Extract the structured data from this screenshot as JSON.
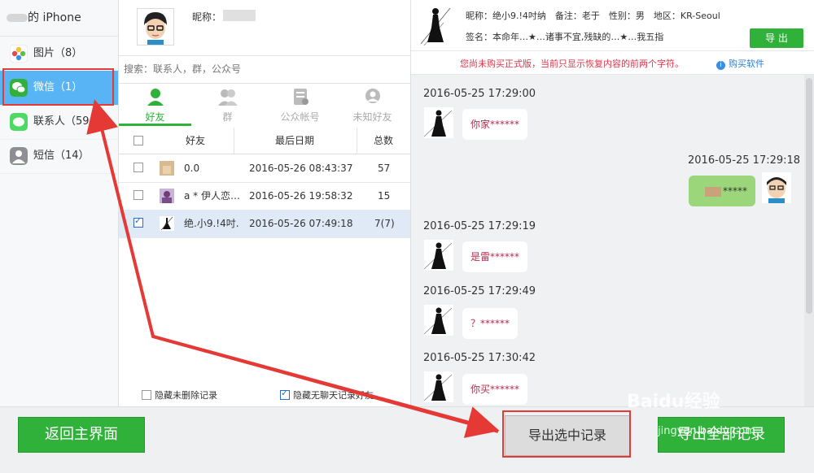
{
  "sidebar": {
    "device_label": "的 iPhone",
    "items": [
      {
        "label": "图片（8）",
        "icon": "photos-icon",
        "active": false
      },
      {
        "label": "微信（1）",
        "icon": "wechat-icon",
        "active": true
      },
      {
        "label": "联系人（59",
        "icon": "contacts-icon",
        "active": false
      },
      {
        "label": "短信（14）",
        "icon": "sms-icon",
        "active": false
      }
    ]
  },
  "account": {
    "nickname_label": "昵称："
  },
  "search": {
    "placeholder": "搜索：联系人，群，公众号"
  },
  "tabs": [
    {
      "label": "好友",
      "icon": "friend-icon",
      "active": true
    },
    {
      "label": "群",
      "icon": "group-icon",
      "active": false
    },
    {
      "label": "公众帐号",
      "icon": "official-account-icon",
      "active": false
    },
    {
      "label": "未知好友",
      "icon": "unknown-friend-icon",
      "active": false
    }
  ],
  "table": {
    "headers": [
      "好友",
      "最后日期",
      "总数"
    ],
    "rows": [
      {
        "name": "0.0",
        "date": "2016-05-26 08:43:37",
        "count": "57",
        "checked": false,
        "selected": false
      },
      {
        "name": "a * 伊人恋…",
        "date": "2016-05-26 19:58:32",
        "count": "15",
        "checked": false,
        "selected": false
      },
      {
        "name": "绝.小9.!4吋.",
        "date": "2016-05-26 07:49:18",
        "count": "7(7)",
        "checked": true,
        "selected": true
      }
    ]
  },
  "options": {
    "hide_deleted": "隐藏未删除记录",
    "hide_no_chat": "隐藏无聊天记录好友"
  },
  "chat_header": {
    "info_line1": "昵称：绝小9.!4吋纳　备注：老于　性别：男　地区：KR-Seoul",
    "info_line2": "签名：本命年…★…诸事不宜,残缺的…★…我五指",
    "export_label": "导 出"
  },
  "notice": {
    "text": "您尚未购买正式版，当前只显示恢复内容的前两个字符。",
    "buy_label": "购买软件",
    "buy_icon_glyph": "i"
  },
  "messages": [
    {
      "time": "2016-05-25 17:29:00",
      "text": "你家******",
      "from_me": false
    },
    {
      "time": "2016-05-25 17:29:18",
      "text": "*****",
      "from_me": true
    },
    {
      "time": "2016-05-25 17:29:19",
      "text": "是雷******",
      "from_me": false
    },
    {
      "time": "2016-05-25 17:29:49",
      "text": "？******",
      "from_me": false
    },
    {
      "time": "2016-05-25 17:30:42",
      "text": "你买******",
      "from_me": false
    }
  ],
  "bottom": {
    "back_label": "返回主界面",
    "export_selected_label": "导出选中记录",
    "export_all_label": "导出全部记录"
  },
  "watermark": {
    "brand": "Baidu经验",
    "url": "jingyan.baidu.com"
  },
  "colors": {
    "accent_green": "#2fb13a",
    "sidebar_active": "#58b4f4",
    "annotation_red": "#e53935"
  }
}
